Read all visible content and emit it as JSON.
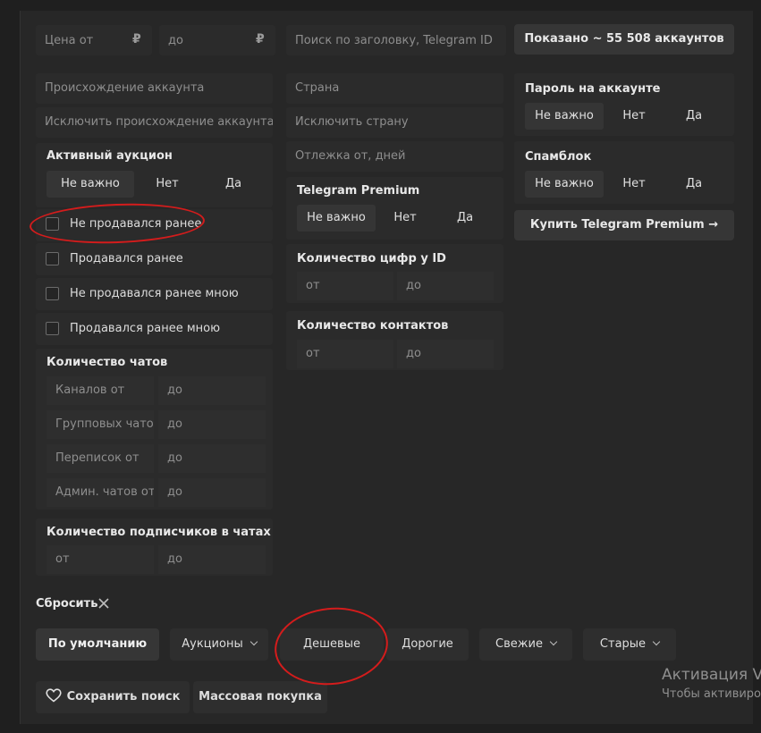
{
  "search": {
    "price_from_placeholder": "Цена от",
    "price_to_placeholder": "до",
    "currency_symbol": "₽",
    "title_search_placeholder": "Поиск по заголовку, Telegram ID",
    "shown_button": "Показано ~ 55 508 аккаунтов"
  },
  "left": {
    "origin_placeholder": "Происхождение аккаунта",
    "exclude_origin_placeholder": "Исключить происхождение аккаунта",
    "auction_label": "Активный аукцион",
    "auction_options": [
      "Не важно",
      "Нет",
      "Да"
    ],
    "checkboxes": [
      "Не продавался ранее",
      "Продавался ранее",
      "Не продавался ранее мною",
      "Продавался ранее мною"
    ],
    "chats_label": "Количество чатов",
    "chats_rows": [
      {
        "from": "Каналов от",
        "to": "до"
      },
      {
        "from": "Групповых чато",
        "to": "до"
      },
      {
        "from": "Переписок от",
        "to": "до"
      },
      {
        "from": "Админ. чатов от",
        "to": "до"
      }
    ],
    "subscribers_label": "Количество подписчиков в чатах",
    "subscribers_from": "от",
    "subscribers_to": "до"
  },
  "middle": {
    "country_placeholder": "Страна",
    "exclude_country_placeholder": "Исключить страну",
    "rest_placeholder": "Отлежка от, дней",
    "premium_label": "Telegram Premium",
    "premium_options": [
      "Не важно",
      "Нет",
      "Да"
    ],
    "id_digits_label": "Количество цифр у ID",
    "id_digits_from": "от",
    "id_digits_to": "до",
    "contacts_label": "Количество контактов",
    "contacts_from": "от",
    "contacts_to": "до"
  },
  "right": {
    "password_label": "Пароль на аккаунте",
    "password_options": [
      "Не важно",
      "Нет",
      "Да"
    ],
    "spamblock_label": "Спамблок",
    "spamblock_options": [
      "Не важно",
      "Нет",
      "Да"
    ],
    "buy_premium_button": "Купить Telegram Premium →"
  },
  "bottom": {
    "reset_label": "Сбросить",
    "sort_buttons": [
      "По умолчанию",
      "Аукционы",
      "Дешевые",
      "Дорогие",
      "Свежие",
      "Старые"
    ],
    "save_search_button": "Сохранить поиск",
    "bulk_buy_button": "Массовая покупка"
  },
  "watermark": {
    "title": "Активация V",
    "subtitle": "Чтобы активиро"
  },
  "colors": {
    "background": "#1f1f1f",
    "panel": "#272727",
    "annotation_circle": "#d41c1c"
  }
}
